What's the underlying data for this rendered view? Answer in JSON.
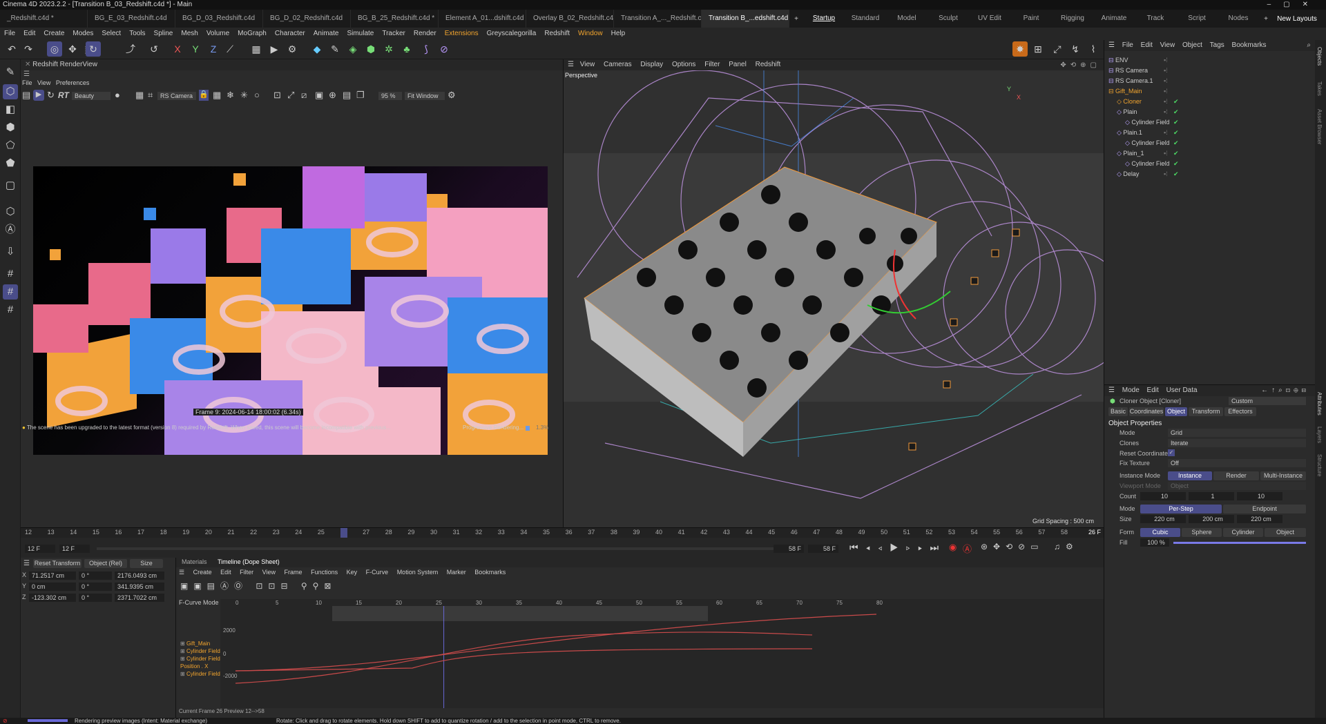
{
  "window_title": "Cinema 4D 2023.2.2 - [Transition B_03_Redshift.c4d *] - Main",
  "doc_tabs": [
    "_Redshift.c4d *",
    "BG_E_03_Redshift.c4d",
    "BG_D_03_Redshift.c4d",
    "BG_D_02_Redshift.c4d",
    "BG_B_25_Redshift.c4d *",
    "Element A_01...dshift.c4d *",
    "Overlay B_02_Redshift.c4d *",
    "Transition A_..._Redshift.c4d",
    "Transition B_...edshift.c4d *"
  ],
  "layouts": [
    "Startup",
    "Standard",
    "Model",
    "Sculpt",
    "UV Edit",
    "Paint",
    "Rigging",
    "Animate",
    "Track",
    "Script",
    "Nodes"
  ],
  "new_layouts": "New Layouts",
  "menu": [
    "File",
    "Edit",
    "Create",
    "Modes",
    "Select",
    "Tools",
    "Spline",
    "Mesh",
    "Volume",
    "MoGraph",
    "Character",
    "Animate",
    "Simulate",
    "Tracker",
    "Render",
    "Extensions",
    "Greyscalegorilla",
    "Redshift",
    "Window",
    "Help"
  ],
  "renderview": {
    "title": "Redshift RenderView",
    "menu": [
      "File",
      "View",
      "Preferences"
    ],
    "aov": "Beauty",
    "camera": "RS Camera",
    "zoom": "95 %",
    "fit": "Fit Window",
    "rt": "RT",
    "frame_info": "Frame  9:  2024-06-14  18:00:02  (6.34s)",
    "message": "The scene has been upgraded to the latest format (version 8) required by Redshift. When saved, this scene will become incompatible with previous...",
    "progress_label": "Progressive Rendering...",
    "progress_pct": "1.3%"
  },
  "viewport": {
    "menu": [
      "View",
      "Cameras",
      "Display",
      "Options",
      "Filter",
      "Panel",
      "Redshift"
    ],
    "name": "Perspective",
    "grid_spacing": "Grid Spacing : 500 cm"
  },
  "objects": {
    "menu": [
      "File",
      "Edit",
      "View",
      "Object",
      "Tags",
      "Bookmarks"
    ],
    "items": [
      {
        "name": "ENV",
        "indent": 0,
        "sel": false,
        "check": false
      },
      {
        "name": "RS Camera",
        "indent": 0,
        "sel": false,
        "check": false
      },
      {
        "name": "RS Camera.1",
        "indent": 0,
        "sel": false,
        "check": false
      },
      {
        "name": "Gift_Main",
        "indent": 0,
        "sel": true,
        "check": false
      },
      {
        "name": "Cloner",
        "indent": 1,
        "sel": true,
        "check": true
      },
      {
        "name": "Plain",
        "indent": 1,
        "sel": false,
        "check": true
      },
      {
        "name": "Cylinder Field",
        "indent": 2,
        "sel": false,
        "check": true
      },
      {
        "name": "Plain.1",
        "indent": 1,
        "sel": false,
        "check": true
      },
      {
        "name": "Cylinder Field",
        "indent": 2,
        "sel": false,
        "check": true
      },
      {
        "name": "Plain_1",
        "indent": 1,
        "sel": false,
        "check": true
      },
      {
        "name": "Cylinder Field",
        "indent": 2,
        "sel": false,
        "check": true
      },
      {
        "name": "Delay",
        "indent": 1,
        "sel": false,
        "check": true
      }
    ]
  },
  "attributes": {
    "menu": [
      "Mode",
      "Edit",
      "User Data"
    ],
    "object_name": "Cloner Object [Cloner]",
    "preset": "Custom",
    "tabs": [
      "Basic",
      "Coordinates",
      "Object",
      "Transform",
      "Effectors"
    ],
    "active_tab": "Object",
    "section": "Object Properties",
    "mode": "Grid",
    "clones": "Iterate",
    "reset_coordinates": "Reset Coordinates",
    "fix_texture": "Off",
    "instance_modes": [
      "Instance",
      "Render Instance",
      "Multi-Instance"
    ],
    "viewport_mode": "Object",
    "count": [
      "10",
      "1",
      "10"
    ],
    "grid_modes": [
      "Per-Step",
      "Endpoint"
    ],
    "size": [
      "220 cm",
      "200 cm",
      "220 cm"
    ],
    "forms": [
      "Cubic",
      "Sphere",
      "Cylinder",
      "Object"
    ],
    "fill": "100 %",
    "labels": {
      "mode": "Mode",
      "clones": "Clones",
      "fix_texture": "Fix Texture",
      "instance_mode": "Instance Mode",
      "viewport_mode": "Viewport Mode",
      "count": "Count",
      "mode2": "Mode",
      "size": "Size",
      "form": "Form",
      "fill": "Fill"
    }
  },
  "timeline": {
    "ticks": [
      "12",
      "13",
      "14",
      "15",
      "16",
      "17",
      "18",
      "19",
      "20",
      "21",
      "22",
      "23",
      "24",
      "25",
      "26",
      "27",
      "28",
      "29",
      "30",
      "31",
      "32",
      "33",
      "34",
      "35",
      "36",
      "37",
      "38",
      "39",
      "40",
      "41",
      "42",
      "43",
      "44",
      "45",
      "46",
      "47",
      "48",
      "49",
      "50",
      "51",
      "52",
      "53",
      "54",
      "55",
      "56",
      "57",
      "58"
    ],
    "current": "26 F",
    "start": "12 F",
    "start2": "12 F",
    "end": "58 F",
    "end2": "58 F"
  },
  "coords": {
    "reset": "Reset Transform",
    "space": "Object (Rel)",
    "size": "Size",
    "rows": [
      {
        "axis": "X",
        "pos": "71.2517 cm",
        "rot": "0 °",
        "size": "2176.0493 cm"
      },
      {
        "axis": "Y",
        "pos": "0 cm",
        "rot": "0 °",
        "size": "341.9395 cm"
      },
      {
        "axis": "Z",
        "pos": "-123.302 cm",
        "rot": "0 °",
        "size": "2371.7022 cm"
      }
    ]
  },
  "dope": {
    "tabs": [
      "Materials",
      "Timeline (Dope Sheet)"
    ],
    "menu": [
      "Create",
      "Edit",
      "Filter",
      "View",
      "Frame",
      "Functions",
      "Key",
      "F-Curve",
      "Motion System",
      "Marker",
      "Bookmarks"
    ],
    "mode": "F-Curve Mode",
    "tracks": [
      "Gift_Main",
      "Cylinder Field",
      "Cylinder Field",
      "Position . X",
      "Cylinder Field"
    ],
    "ruler": [
      "0",
      "5",
      "10",
      "15",
      "20",
      "25",
      "30",
      "35",
      "40",
      "45",
      "50",
      "55",
      "60",
      "65",
      "70",
      "75",
      "80"
    ],
    "yvals": [
      "2000",
      "0",
      "-2000"
    ],
    "current": "26",
    "footer": "Current Frame  26  Preview  12-->58"
  },
  "status": {
    "left": "Rendering preview images (Intent: Material exchange)",
    "right": "Rotate: Click and drag to rotate elements. Hold down SHIFT to add to quantize rotation / add to the selection in point mode, CTRL to remove."
  }
}
